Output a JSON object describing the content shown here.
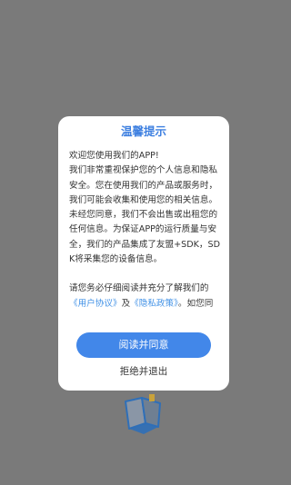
{
  "dialog": {
    "title": "温馨提示",
    "paragraphs": [
      "欢迎您使用我们的APP!",
      "我们非常重视保护您的个人信息和隐私安全。您在使用我们的产品或服务时，我们可能会收集和使用您的相关信息。未经您同意，我们不会出售或出租您的任何信息。为保证APP的运行质量与安全，我们的产品集成了友盟+SDK，SDK将采集您的设备信息。"
    ],
    "read_prompt_before": "请您务必仔细阅读并充分了解我们的",
    "user_agreement_link": "《用户协议》",
    "and_text": "及",
    "privacy_policy_link": "《隐私政策》",
    "read_prompt_after": "。如您同",
    "agree_button": "阅读并同意",
    "reject_button": "拒绝并退出"
  },
  "colors": {
    "overlay": "#7a7a7a",
    "title": "#3d7fe0",
    "button": "#4287e9",
    "link": "#3d8fe6"
  },
  "icons": {
    "background_logo": "book-icon"
  }
}
